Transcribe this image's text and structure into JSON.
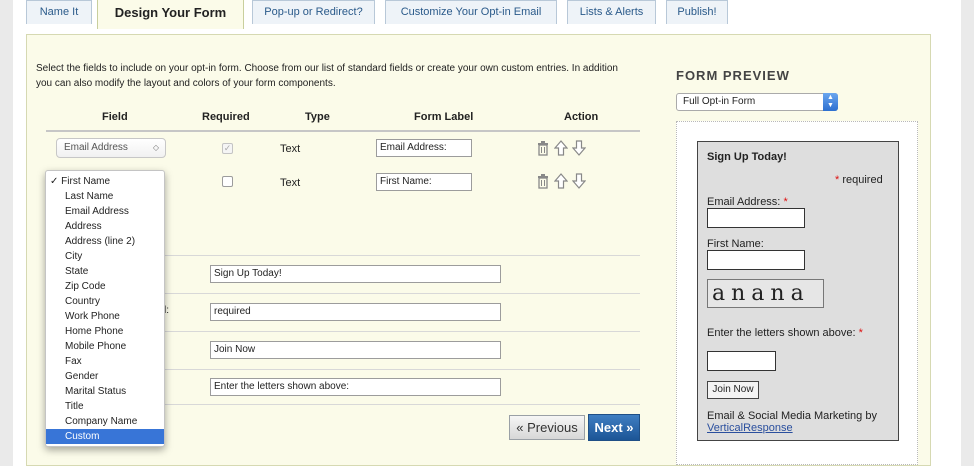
{
  "tabs": [
    "Name It",
    "Design Your Form",
    "Pop-up or Redirect?",
    "Customize Your Opt-in Email",
    "Lists & Alerts",
    "Publish!"
  ],
  "intro_text": "Select the fields to include on your opt-in form. Choose from our list of standard fields or create your own custom entries. In addition you can also modify the layout and colors of your form components.",
  "table": {
    "headers": {
      "field": "Field",
      "required": "Required",
      "type": "Type",
      "form_label": "Form Label",
      "action": "Action"
    },
    "rows": [
      {
        "field": "Email Address",
        "required": true,
        "type": "Text",
        "label": "Email Address:"
      },
      {
        "field": "First Name",
        "required": false,
        "type": "Text",
        "label": "First Name:"
      }
    ]
  },
  "field_dropdown": {
    "checkmark": "✓",
    "options": [
      "First Name",
      "Last Name",
      "Email Address",
      "Address",
      "Address (line 2)",
      "City",
      "State",
      "Zip Code",
      "Country",
      "Work Phone",
      "Home Phone",
      "Mobile Phone",
      "Fax",
      "Gender",
      "Marital Status",
      "Title",
      "Company Name",
      "Custom"
    ],
    "selected": "First Name",
    "highlighted": "Custom"
  },
  "settings": {
    "colon_fragment": "l:",
    "form_title_value": "Sign Up Today!",
    "required_text_value": "required",
    "button_text_value": "Join Now",
    "captcha_text_value": "Enter the letters shown above:"
  },
  "nav": {
    "previous": "« Previous",
    "next": "Next »"
  },
  "preview": {
    "title": "FORM PREVIEW",
    "style_select": "Full Opt-in Form",
    "form_heading": "Sign Up Today!",
    "asterisk": "*",
    "required_note": "required",
    "email_label": "Email Address:",
    "first_name_label": "First Name:",
    "captcha_image_text": "anana",
    "captcha_label": "Enter the letters shown above:",
    "join_button": "Join Now",
    "footer_text": "Email & Social Media Marketing by",
    "footer_link": "VerticalResponse"
  },
  "colors": {
    "accent_blue": "#1c5596",
    "selected_option": "#3875d7",
    "panel_bg": "#fbfbe9",
    "required_red": "#d11"
  }
}
